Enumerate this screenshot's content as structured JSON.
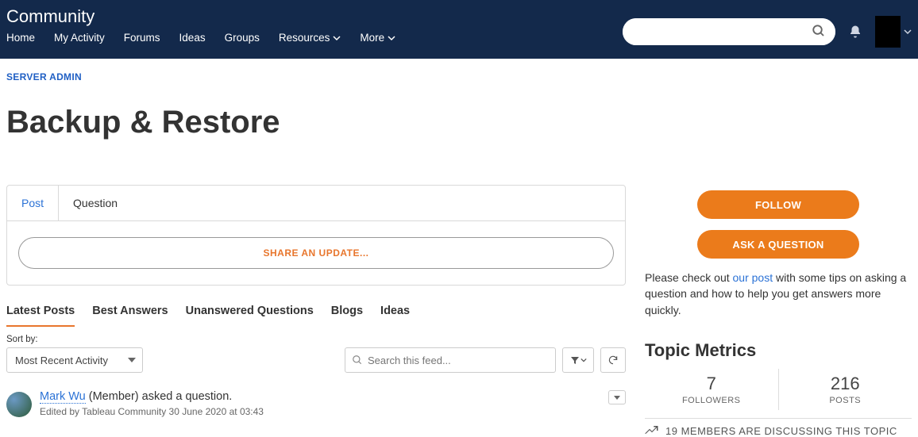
{
  "header": {
    "brand": "Community",
    "nav": [
      "Home",
      "My Activity",
      "Forums",
      "Ideas",
      "Groups",
      "Resources",
      "More"
    ],
    "nav_dropdown": [
      false,
      false,
      false,
      false,
      false,
      true,
      true
    ]
  },
  "crumb": {
    "label": "SERVER ADMIN"
  },
  "page": {
    "title": "Backup & Restore"
  },
  "compose": {
    "tabs": [
      "Post",
      "Question"
    ],
    "active": 0,
    "share": "SHARE AN UPDATE..."
  },
  "feed": {
    "tabs": [
      "Latest Posts",
      "Best Answers",
      "Unanswered Questions",
      "Blogs",
      "Ideas"
    ],
    "active": 0,
    "sort_label": "Sort by:",
    "sort_value": "Most Recent Activity",
    "search_placeholder": "Search this feed..."
  },
  "post": {
    "author": "Mark Wu",
    "role_text": " (Member) asked a question.",
    "meta": "Edited by Tableau Community 30 June 2020 at 03:43"
  },
  "sidebar": {
    "follow": "FOLLOW",
    "ask": "ASK A QUESTION",
    "tip_pre": "Please check out ",
    "tip_link": "our post",
    "tip_post": " with some tips on asking a question and how to help you get answers more quickly.",
    "metrics_title": "Topic Metrics",
    "metrics": [
      {
        "num": "7",
        "label": "FOLLOWERS"
      },
      {
        "num": "216",
        "label": "POSTS"
      }
    ],
    "discuss": "19 MEMBERS ARE DISCUSSING THIS TOPIC"
  }
}
